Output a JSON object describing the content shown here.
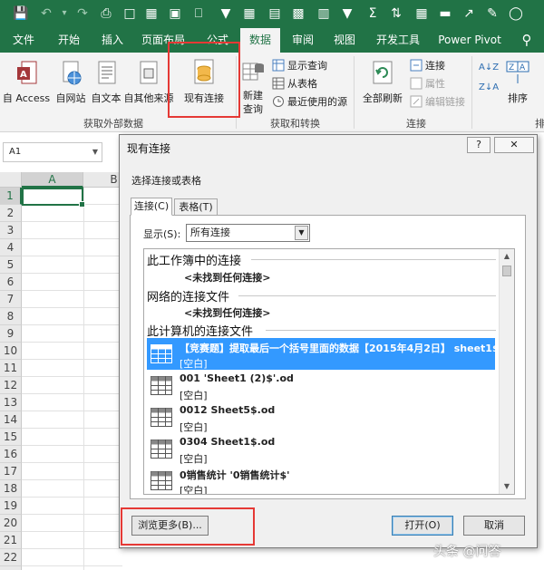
{
  "ribbon": {
    "tabs": [
      {
        "label": "文件"
      },
      {
        "label": "开始"
      },
      {
        "label": "插入"
      },
      {
        "label": "页面布局"
      },
      {
        "label": "公式"
      },
      {
        "label": "数据"
      },
      {
        "label": "审阅"
      },
      {
        "label": "视图"
      },
      {
        "label": "开发工具"
      },
      {
        "label": "Power Pivot"
      }
    ],
    "external": {
      "access": "自 Access",
      "web": "自网站",
      "text": "自文本",
      "other": "自其他来源",
      "existing": "现有连接",
      "group": "获取外部数据"
    },
    "transform": {
      "new_query_1": "新建",
      "new_query_2": "查询",
      "show_queries": "显示查询",
      "from_table": "从表格",
      "recent": "最近使用的源",
      "group": "获取和转换"
    },
    "connections": {
      "refresh": "全部刷新",
      "conn": "连接",
      "props": "属性",
      "edit_links": "编辑链接",
      "group": "连接"
    },
    "sort": {
      "label": "排序",
      "group_partial": "排"
    }
  },
  "namebox": {
    "value": "A1"
  },
  "sheet": {
    "columns": [
      "A",
      "B"
    ],
    "rows": [
      "1",
      "2",
      "3",
      "4",
      "5",
      "6",
      "7",
      "8",
      "9",
      "10",
      "11",
      "12",
      "13",
      "14",
      "15",
      "16",
      "17",
      "18",
      "19",
      "20",
      "21",
      "22",
      "23"
    ]
  },
  "dialog": {
    "title": "现有连接",
    "help": "?",
    "close": "✕",
    "subtitle": "选择连接或表格",
    "tabs": [
      "连接(C)",
      "表格(T)"
    ],
    "show_label": "显示(S):",
    "show_value": "所有连接",
    "sections": [
      {
        "title": "此工作簿中的连接",
        "empty": "<未找到任何连接>"
      },
      {
        "title": "网络的连接文件",
        "empty": "<未找到任何连接>"
      },
      {
        "title": "此计算机的连接文件"
      }
    ],
    "items": [
      {
        "name": "【竞赛题】提取最后一个括号里面的数据【2015年4月2日】 sheet1$",
        "desc": "[空白]"
      },
      {
        "name": "001 'Sheet1 (2)$'.od",
        "desc": "[空白]"
      },
      {
        "name": "0012 Sheet5$.od",
        "desc": "[空白]"
      },
      {
        "name": "0304 Sheet1$.od",
        "desc": "[空白]"
      },
      {
        "name": "0销售统计 '0销售统计$'",
        "desc": "[空白]"
      }
    ],
    "browse": "浏览更多(B)...",
    "open": "打开(O)",
    "cancel": "取消"
  },
  "watermark": "头条 @问答",
  "colors": {
    "excel_green": "#217346",
    "highlight_red": "#e53935",
    "selection_blue": "#3399ff"
  }
}
